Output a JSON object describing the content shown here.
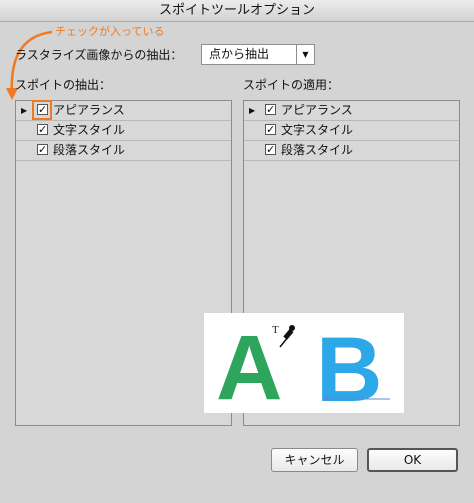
{
  "window": {
    "title": "スポイトツールオプション"
  },
  "annotation": {
    "text": "チェックが入っている",
    "color": "#f07a22"
  },
  "rasterize": {
    "label": "ラスタライズ画像からの抽出：",
    "selected": "点から抽出"
  },
  "extract_panel": {
    "label": "スポイトの抽出：",
    "items": [
      {
        "label": "アピアランス",
        "checked": true,
        "expandable": true,
        "highlighted": true
      },
      {
        "label": "文字スタイル",
        "checked": true,
        "expandable": false
      },
      {
        "label": "段落スタイル",
        "checked": true,
        "expandable": false
      }
    ]
  },
  "apply_panel": {
    "label": "スポイトの適用：",
    "items": [
      {
        "label": "アピアランス",
        "checked": true,
        "expandable": true
      },
      {
        "label": "文字スタイル",
        "checked": true,
        "expandable": false
      },
      {
        "label": "段落スタイル",
        "checked": true,
        "expandable": false
      }
    ]
  },
  "sample": {
    "letter_a": "A",
    "letter_b": "B",
    "color_a": "#2ea55c",
    "color_b": "#2ca8e8",
    "cursor_t": "T",
    "cursor_icon": "eyedropper-icon"
  },
  "buttons": {
    "cancel": "キャンセル",
    "ok": "OK"
  }
}
